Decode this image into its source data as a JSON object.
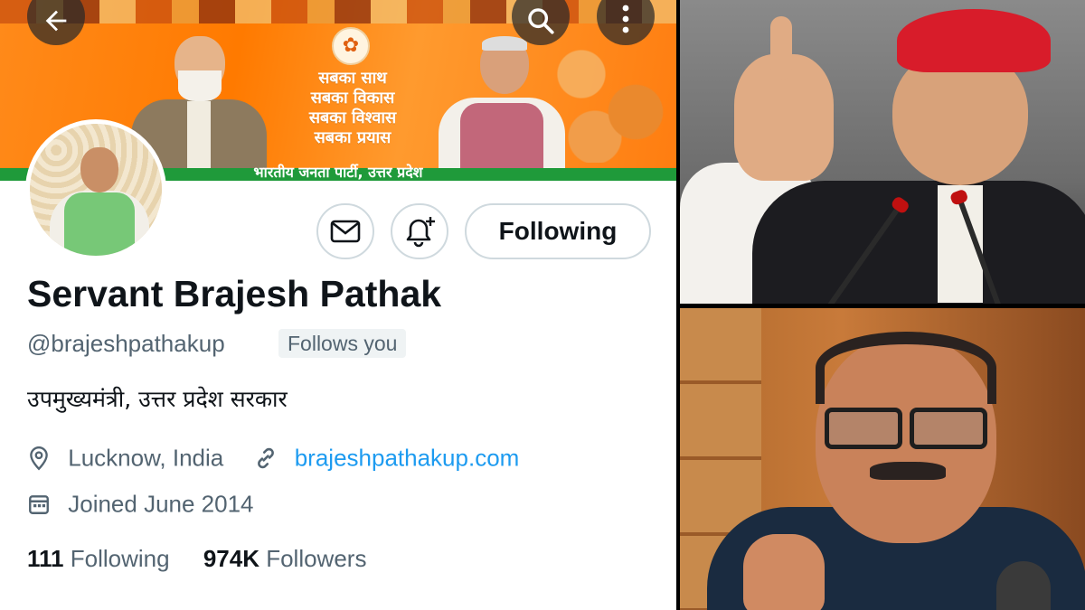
{
  "nav": {
    "back_icon": "arrow-left-icon",
    "search_icon": "search-icon",
    "more_icon": "more-vertical-icon"
  },
  "banner": {
    "slogan_lines": [
      "सबका साथ",
      "सबका विकास",
      "सबका विश्वास",
      "सबका प्रयास"
    ],
    "party_name": "भारतीय जनता पार्टी, उत्तर प्रदेश",
    "colors": {
      "saffron": "#ff7a00",
      "green": "#1f9a3a"
    }
  },
  "actions": {
    "mail_icon": "mail-icon",
    "notify_icon": "bell-plus-icon",
    "following_label": "Following"
  },
  "profile": {
    "name": "Servant Brajesh Pathak",
    "handle": "@brajeshpathakup",
    "follows_you": "Follows you",
    "bio": "उपमुख्यमंत्री, उत्तर प्रदेश सरकार",
    "location": "Lucknow, India",
    "website": "brajeshpathakup.com",
    "joined": "Joined June 2014",
    "following_count": "111",
    "following_label": "Following",
    "followers_count": "974K",
    "followers_label": "Followers"
  },
  "colors": {
    "link": "#1d9bf0",
    "secondary_text": "#536471",
    "primary_text": "#0f1419"
  }
}
